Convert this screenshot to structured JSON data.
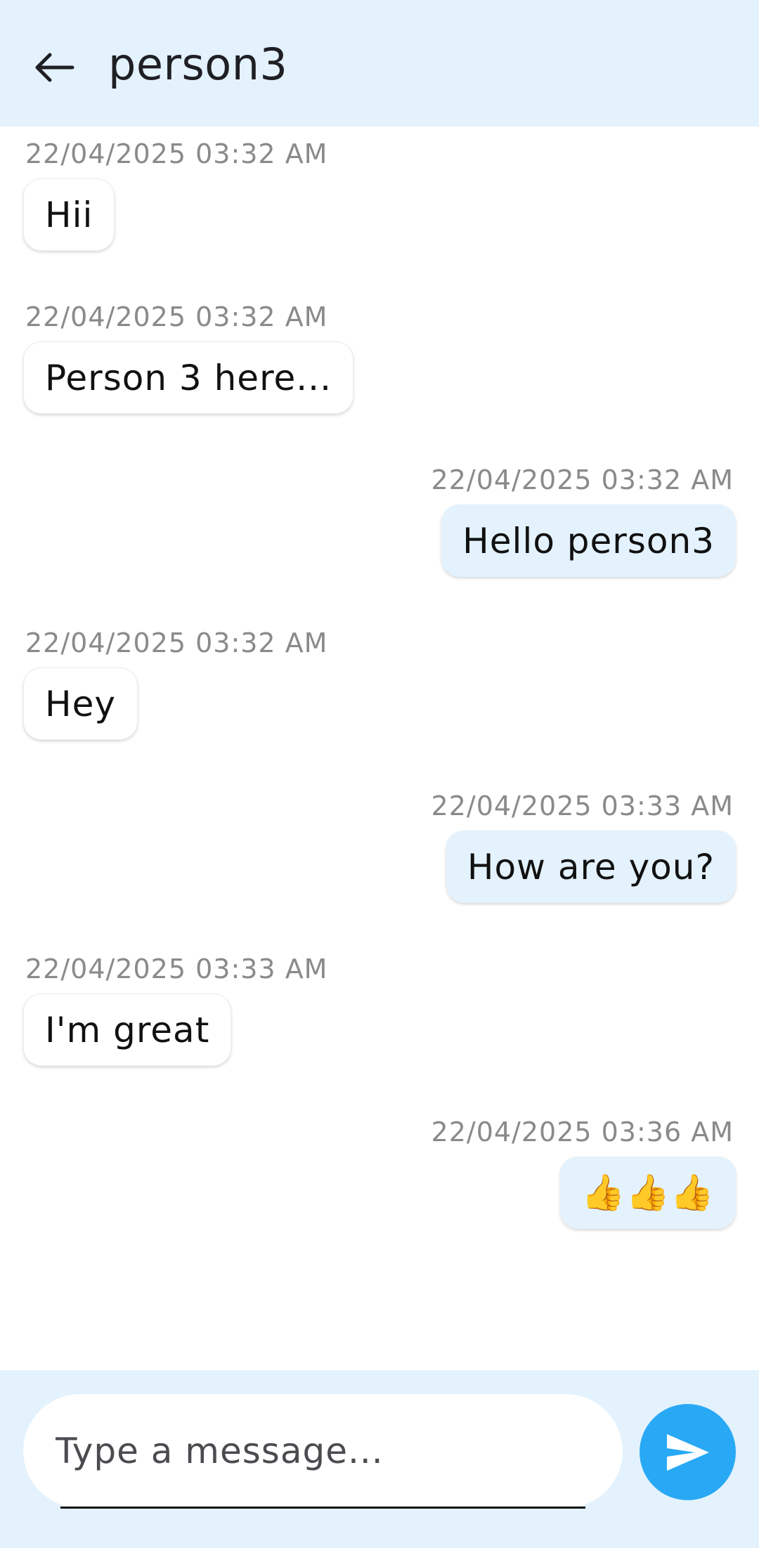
{
  "header": {
    "back_icon": "arrow-left-icon",
    "title": "person3",
    "background": "#e3f2fd"
  },
  "messages": [
    {
      "direction": "incoming",
      "timestamp": "22/04/2025 03:32 AM",
      "text": "Hii"
    },
    {
      "direction": "incoming",
      "timestamp": "22/04/2025 03:32 AM",
      "text": "Person 3 here..."
    },
    {
      "direction": "outgoing",
      "timestamp": "22/04/2025 03:32 AM",
      "text": "Hello person3"
    },
    {
      "direction": "incoming",
      "timestamp": "22/04/2025 03:32 AM",
      "text": "Hey"
    },
    {
      "direction": "outgoing",
      "timestamp": "22/04/2025 03:33 AM",
      "text": "How are you?"
    },
    {
      "direction": "incoming",
      "timestamp": "22/04/2025 03:33 AM",
      "text": "I'm great"
    },
    {
      "direction": "outgoing",
      "timestamp": "22/04/2025 03:36 AM",
      "text": "👍👍👍"
    }
  ],
  "composer": {
    "value": "",
    "placeholder": "Type a message...",
    "send_icon": "send-icon",
    "send_color": "#29a9f5"
  }
}
